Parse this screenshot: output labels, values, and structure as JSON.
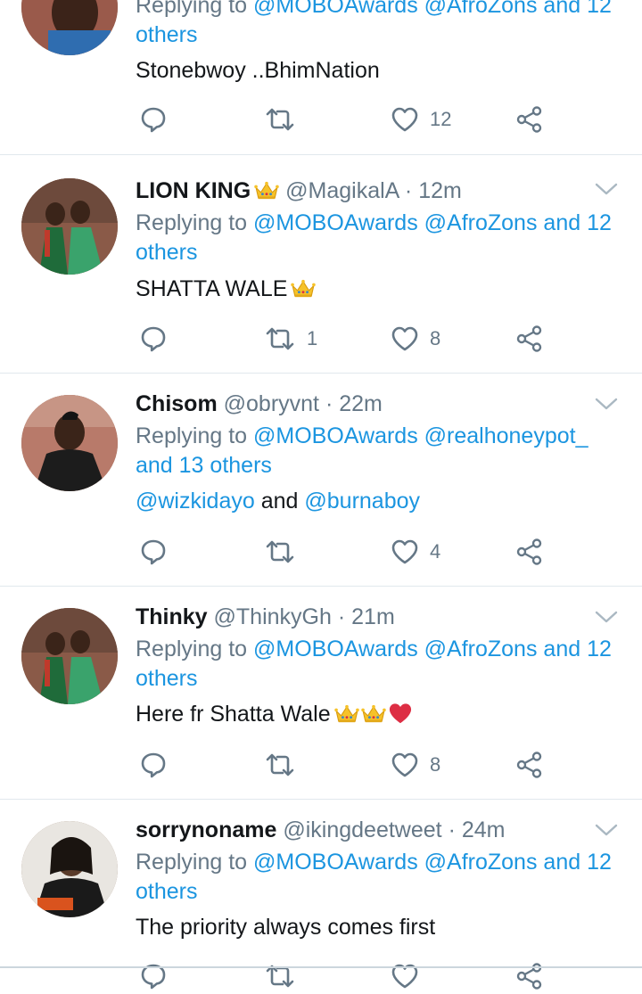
{
  "colors": {
    "link": "#1b95e0",
    "muted": "#657786",
    "text": "#14171a",
    "divider": "#e1e8ed"
  },
  "tweets": [
    {
      "reply_prefix": "Replying to",
      "reply_mentions": "@MOBOAwards @AfroZons and 12",
      "reply_rest": "others",
      "body": "Stonebwoy ..BhimNation",
      "replies": "",
      "retweets": "",
      "likes": "12"
    },
    {
      "name": "LION KING",
      "name_emoji": "crown",
      "handle": "@MagikalA",
      "time": "12m",
      "reply_prefix": "Replying to",
      "reply_mentions": "@MOBOAwards @AfroZons and 12",
      "reply_rest": "others",
      "body": "SHATTA WALE",
      "body_emoji": "crown",
      "retweets": "1",
      "likes": "8"
    },
    {
      "name": "Chisom",
      "handle": "@obryvnt",
      "time": "22m",
      "reply_prefix": "Replying to",
      "reply_mentions": "@MOBOAwards @realhoneypot_",
      "reply_rest": "and 13 others",
      "body_mention_1": "@wizkidayo",
      "body_and": "and",
      "body_mention_2": "@burnaboy",
      "retweets": "",
      "likes": "4"
    },
    {
      "name": "Thinky",
      "handle": "@ThinkyGh",
      "time": "21m",
      "reply_prefix": "Replying to",
      "reply_mentions": "@MOBOAwards @AfroZons and 12",
      "reply_rest": "others",
      "body": "Here fr Shatta Wale",
      "body_emoji": "crown crown red-heart",
      "retweets": "",
      "likes": "8"
    },
    {
      "name": "sorrynoname",
      "handle": "@ikingdeetweet",
      "time": "24m",
      "reply_prefix": "Replying to",
      "reply_mentions": "@MOBOAwards @AfroZons and 12",
      "reply_rest": "others",
      "body": "The priority always comes first"
    }
  ],
  "separator_dot": "·",
  "icons": [
    "reply-icon",
    "retweet-icon",
    "like-icon",
    "share-icon",
    "chevron-down-icon",
    "crown-emoji",
    "red-heart-emoji"
  ]
}
